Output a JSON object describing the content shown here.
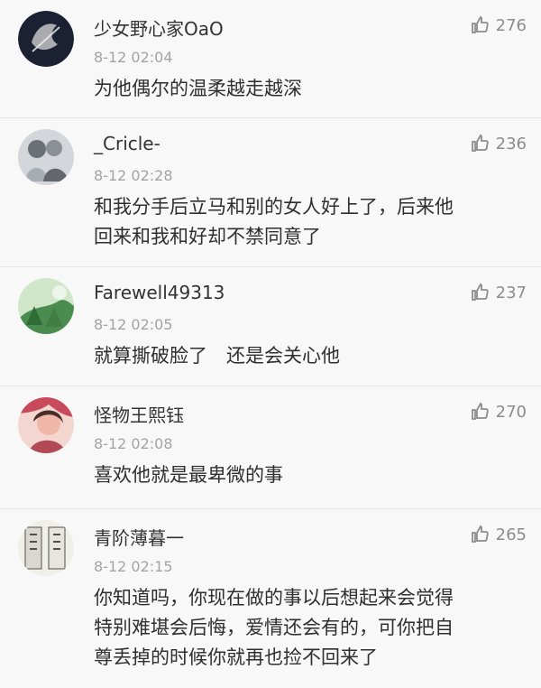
{
  "comments": [
    {
      "username": "少女野心家OaO",
      "time": "8-12 02:04",
      "text": "为他偶尔的温柔越走越深",
      "likes": "276",
      "avatar_icon": "dark-avatar-icon",
      "avatar_colors": [
        "#1b2133",
        "#d9d9d9"
      ]
    },
    {
      "username": "_Cricle-",
      "time": "8-12 02:28",
      "text": "和我分手后立马和别的女人好上了，后来他\n回来和我和好却不禁同意了",
      "likes": "236",
      "avatar_icon": "couple-photo-avatar-icon",
      "avatar_colors": [
        "#9aa0a6",
        "#5f6368"
      ]
    },
    {
      "username": "Farewell49313",
      "time": "8-12 02:05",
      "text": "就算撕破脸了　还是会关心他",
      "likes": "237",
      "avatar_icon": "green-scene-avatar-icon",
      "avatar_colors": [
        "#4a8b4f",
        "#cfe7c8"
      ]
    },
    {
      "username": "怪物王熙钰",
      "time": "8-12 02:08",
      "text": "喜欢他就是最卑微的事",
      "likes": "270",
      "avatar_icon": "portrait-avatar-icon",
      "avatar_colors": [
        "#c94b5b",
        "#f0b7a8"
      ]
    },
    {
      "username": "青阶薄暮一",
      "time": "8-12 02:15",
      "text": "你知道吗，你现在做的事以后想起来会觉得\n特别难堪会后悔，爱情还会有的，可你把自\n尊丢掉的时候你就再也捡不回来了",
      "likes": "265",
      "avatar_icon": "book-cover-avatar-icon",
      "avatar_colors": [
        "#d9d7cf",
        "#505050"
      ]
    }
  ],
  "ui": {
    "like_icon": "thumbs-up-icon"
  }
}
